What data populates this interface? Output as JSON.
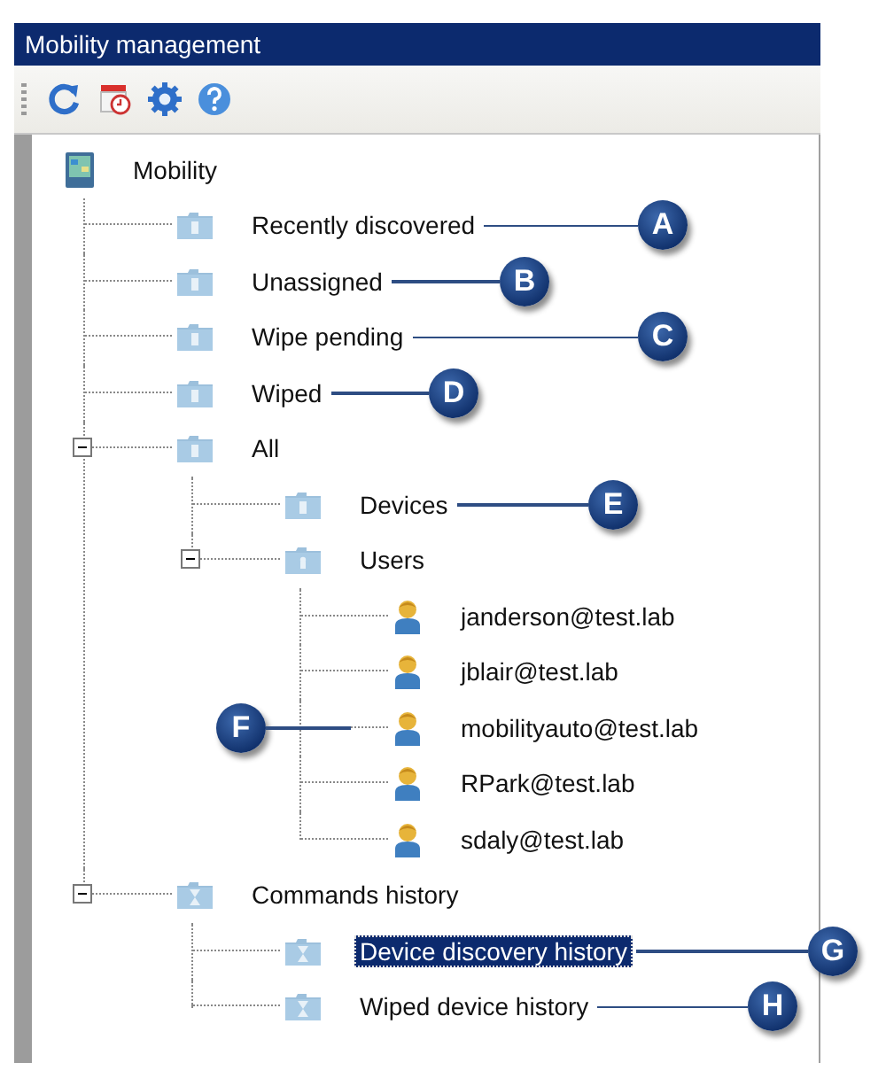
{
  "window": {
    "title": "Mobility management"
  },
  "toolbar": {
    "buttons": [
      {
        "kind": "refresh"
      },
      {
        "kind": "schedule"
      },
      {
        "kind": "settings"
      },
      {
        "kind": "help"
      }
    ]
  },
  "tree": [
    {
      "label": "Mobility",
      "kind": "root",
      "selected": false,
      "children": [
        {
          "label": "Recently discovered",
          "kind": "folder",
          "selected": false,
          "callout": "A"
        },
        {
          "label": "Unassigned",
          "kind": "folder",
          "selected": false,
          "callout": "B"
        },
        {
          "label": "Wipe pending",
          "kind": "folder",
          "selected": false,
          "callout": "C"
        },
        {
          "label": "Wiped",
          "kind": "folder",
          "selected": false,
          "callout": "D"
        },
        {
          "label": "All",
          "kind": "folder",
          "selected": false,
          "expanded": true,
          "children": [
            {
              "label": "Devices",
              "kind": "folder",
              "selected": false,
              "callout": "E"
            },
            {
              "label": "Users",
              "kind": "user-folder",
              "selected": false,
              "expanded": true,
              "children_callout": "F",
              "children": [
                {
                  "label": "janderson@test.lab",
                  "kind": "user",
                  "selected": false
                },
                {
                  "label": "jblair@test.lab",
                  "kind": "user",
                  "selected": false
                },
                {
                  "label": "mobilityauto@test.lab",
                  "kind": "user",
                  "selected": false
                },
                {
                  "label": "RPark@test.lab",
                  "kind": "user",
                  "selected": false
                },
                {
                  "label": "sdaly@test.lab",
                  "kind": "user",
                  "selected": false
                }
              ]
            }
          ]
        },
        {
          "label": "Commands history",
          "kind": "history-folder",
          "selected": false,
          "expanded": true,
          "children": [
            {
              "label": "Device discovery history",
              "kind": "history-folder",
              "selected": true,
              "callout": "G"
            },
            {
              "label": "Wiped device history",
              "kind": "history-folder",
              "selected": false,
              "callout": "H"
            }
          ]
        }
      ]
    }
  ]
}
